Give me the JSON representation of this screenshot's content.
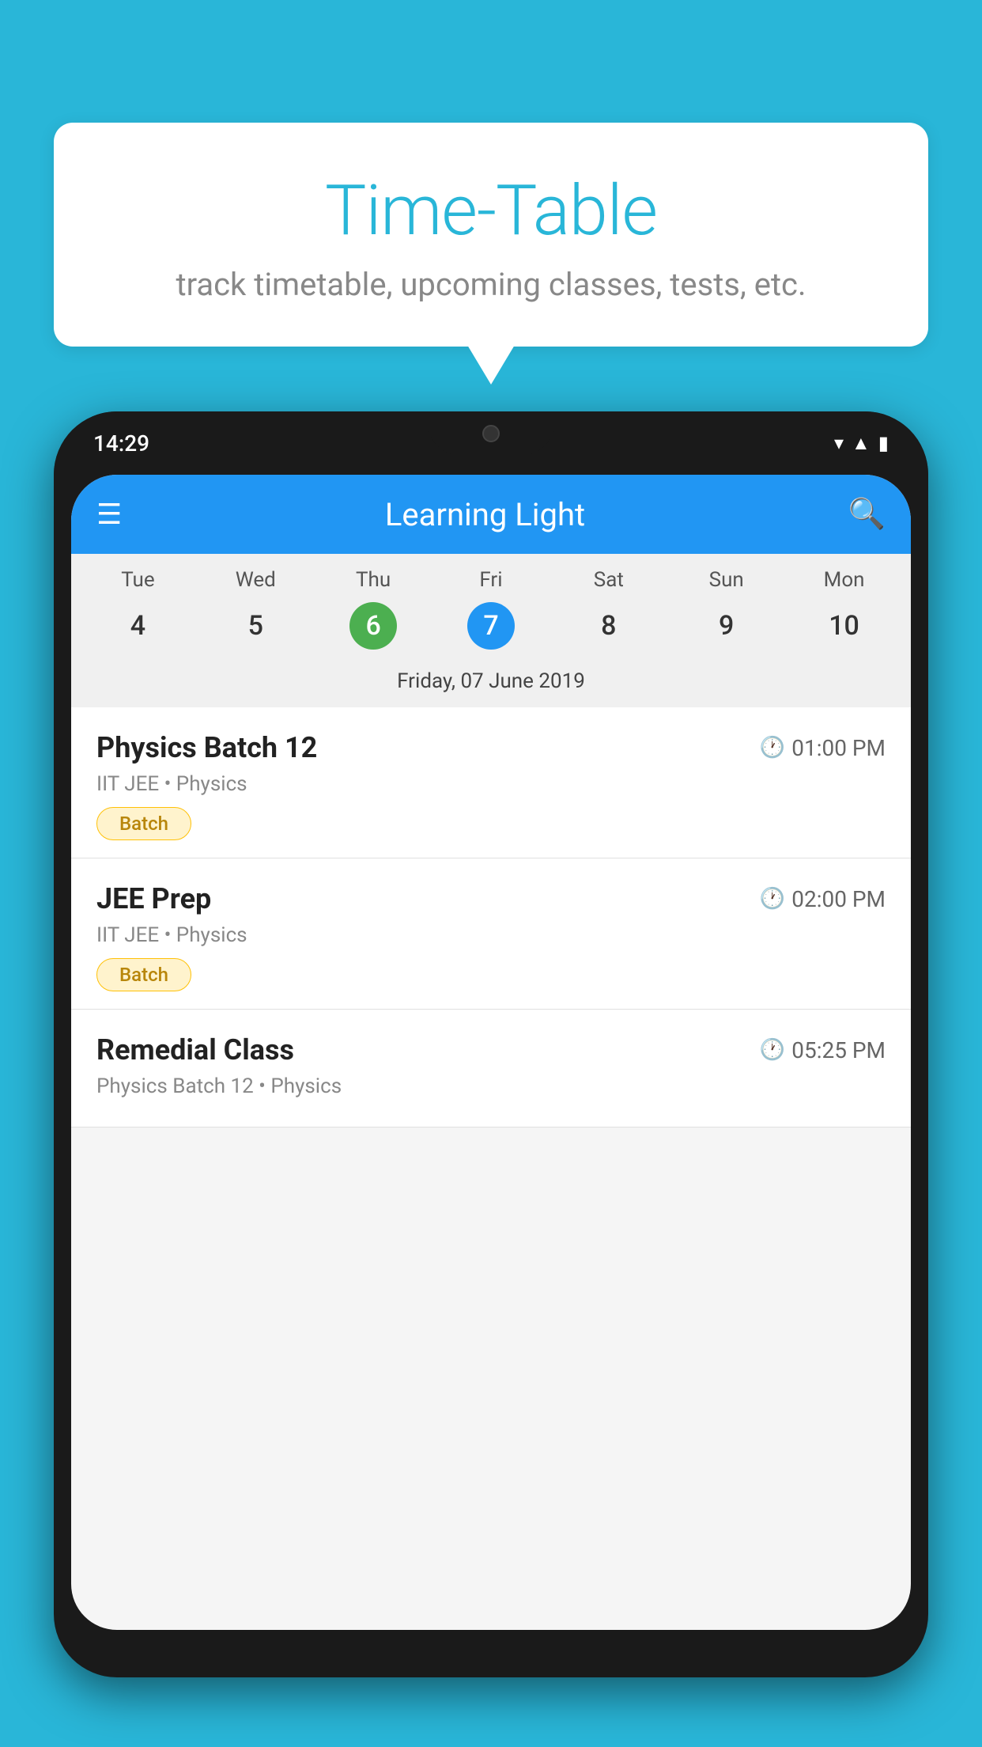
{
  "background_color": "#29b6d8",
  "bubble": {
    "title": "Time-Table",
    "subtitle": "track timetable, upcoming classes, tests, etc."
  },
  "phone": {
    "status_bar": {
      "time": "14:29"
    },
    "app_bar": {
      "title": "Learning Light"
    },
    "calendar": {
      "weekdays": [
        "Tue",
        "Wed",
        "Thu",
        "Fri",
        "Sat",
        "Sun",
        "Mon"
      ],
      "dates": [
        {
          "num": "4",
          "state": "normal"
        },
        {
          "num": "5",
          "state": "normal"
        },
        {
          "num": "6",
          "state": "today"
        },
        {
          "num": "7",
          "state": "selected"
        },
        {
          "num": "8",
          "state": "normal"
        },
        {
          "num": "9",
          "state": "normal"
        },
        {
          "num": "10",
          "state": "normal"
        }
      ],
      "selected_date_label": "Friday, 07 June 2019"
    },
    "classes": [
      {
        "name": "Physics Batch 12",
        "time": "01:00 PM",
        "subject": "IIT JEE • Physics",
        "tag": "Batch"
      },
      {
        "name": "JEE Prep",
        "time": "02:00 PM",
        "subject": "IIT JEE • Physics",
        "tag": "Batch"
      },
      {
        "name": "Remedial Class",
        "time": "05:25 PM",
        "subject": "Physics Batch 12 • Physics",
        "tag": ""
      }
    ]
  }
}
